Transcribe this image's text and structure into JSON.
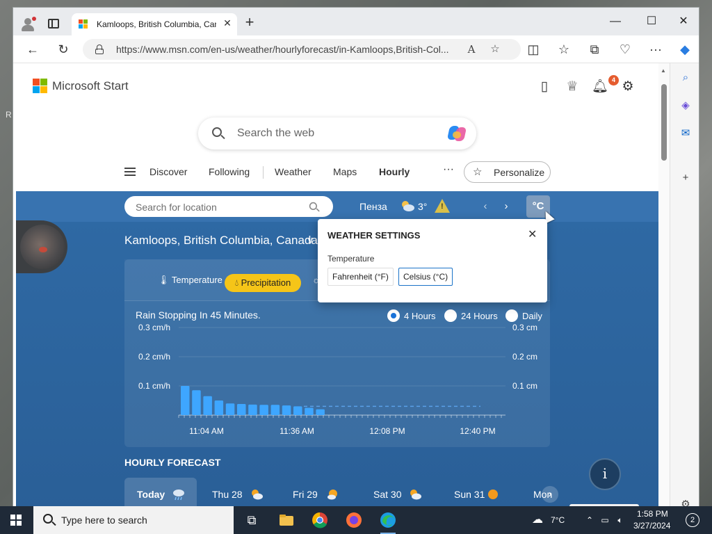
{
  "desktop": {
    "edge_letter": "R"
  },
  "browser": {
    "tab_title": "Kamloops, British Columbia, Canada",
    "url": "https://www.msn.com/en-us/weather/hourlyforecast/in-Kamloops,British-Col...",
    "reader_label": "A"
  },
  "header": {
    "brand": "Microsoft Start",
    "notification_count": "4",
    "search_placeholder": "Search the web"
  },
  "menu": {
    "items": [
      "Discover",
      "Following",
      "Weather",
      "Maps",
      "Hourly"
    ],
    "more": "···",
    "personalize": "Personalize"
  },
  "weather_bar": {
    "location_placeholder": "Search for location",
    "current_city": "Пенза",
    "current_temp": "3°",
    "unit": "°C"
  },
  "location_title": "Kamloops, British Columbia, Canada",
  "chart_tabs": {
    "temperature": "Temperature",
    "precipitation": "Precipitation"
  },
  "summary": "Rain Stopping In 45 Minutes.",
  "ranges": [
    "4 Hours",
    "24 Hours",
    "Daily"
  ],
  "selected_range": "4 Hours",
  "chart_data": {
    "type": "bar",
    "ylabel_left": [
      "0.3 cm/h",
      "0.2 cm/h",
      "0.1 cm/h"
    ],
    "ylabel_right": [
      "0.3 cm",
      "0.2 cm",
      "0.1 cm"
    ],
    "xticks": [
      "11:04 AM",
      "11:36 AM",
      "12:08 PM",
      "12:40 PM"
    ],
    "ylim": [
      0,
      0.3
    ],
    "values": [
      0.1,
      0.085,
      0.065,
      0.05,
      0.04,
      0.038,
      0.036,
      0.035,
      0.035,
      0.033,
      0.03,
      0.025,
      0.02
    ],
    "forecast_line": 0.03,
    "grid": true
  },
  "settings": {
    "title": "WEATHER SETTINGS",
    "label": "Temperature",
    "options": [
      "Fahrenheit (°F)",
      "Celsius (°C)"
    ],
    "selected": "Celsius (°C)"
  },
  "hourly": {
    "title": "HOURLY FORECAST",
    "days": [
      "Today",
      "Thu 28",
      "Fri 29",
      "Sat 30",
      "Sun 31",
      "Mon"
    ]
  },
  "taskbar": {
    "search_placeholder": "Type here to search",
    "weather_temp": "7°C",
    "time": "1:58 PM",
    "date": "3/27/2024",
    "notifications": "2"
  }
}
